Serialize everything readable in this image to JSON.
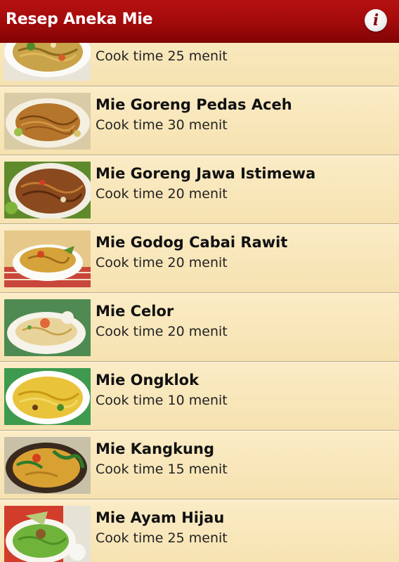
{
  "app": {
    "title": "Resep Aneka Mie"
  },
  "icons": {
    "info": "info-icon"
  },
  "recipes": [
    {
      "name": "",
      "time": "Cook time 25 menit"
    },
    {
      "name": "Mie Goreng Pedas Aceh",
      "time": "Cook time 30 menit"
    },
    {
      "name": "Mie Goreng Jawa Istimewa",
      "time": "Cook time 20 menit"
    },
    {
      "name": "Mie Godog Cabai Rawit",
      "time": "Cook time 20 menit"
    },
    {
      "name": "Mie Celor",
      "time": "Cook time 20 menit"
    },
    {
      "name": "Mie Ongklok",
      "time": "Cook time 10 menit"
    },
    {
      "name": "Mie Kangkung",
      "time": "Cook time 15 menit"
    },
    {
      "name": "Mie Ayam Hijau",
      "time": "Cook time 25 menit"
    }
  ]
}
